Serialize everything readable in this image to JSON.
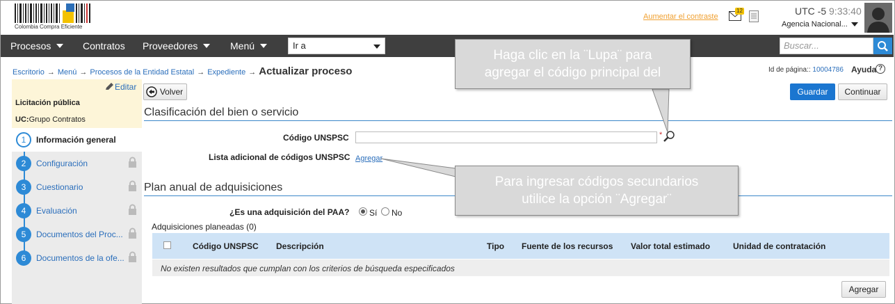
{
  "header": {
    "logo_text": "Colombia Compra Eficiente",
    "contrast_link": "Aumentar el contraste",
    "mail_count": "12",
    "utc_label": "UTC -5",
    "time": "9:33:40",
    "agency": "Agencia Nacional..."
  },
  "nav": {
    "items": [
      "Procesos",
      "Contratos",
      "Proveedores",
      "Menú"
    ],
    "goto": "Ir a",
    "search_placeholder": "Buscar..."
  },
  "breadcrumb": {
    "items": [
      "Escritorio",
      "Menú",
      "Procesos de la Entidad Estatal",
      "Expediente"
    ],
    "separator": "→",
    "current": "Actualizar proceso"
  },
  "page_meta": {
    "id_label": "Id de página::",
    "id_value": "10004786",
    "help": "Ayuda",
    "help_icon_glyph": "?"
  },
  "sidebar": {
    "edit": "Editar",
    "process_type": "Licitación pública",
    "uc_label": "UC:",
    "uc_value": "Grupo Contratos",
    "steps": [
      {
        "num": "1",
        "label": "Información general"
      },
      {
        "num": "2",
        "label": "Configuración"
      },
      {
        "num": "3",
        "label": "Cuestionario"
      },
      {
        "num": "4",
        "label": "Evaluación"
      },
      {
        "num": "5",
        "label": "Documentos del Proc..."
      },
      {
        "num": "6",
        "label": "Documentos de la ofe..."
      }
    ]
  },
  "toolbar": {
    "back": "Volver",
    "save": "Guardar",
    "continue": "Continuar"
  },
  "section1": {
    "title": "Clasificación del bien o servicio",
    "code_label": "Código UNSPSC",
    "required_mark": "*",
    "extra_label": "Lista adicional de códigos UNSPSC",
    "add_link": "Agregar"
  },
  "section2": {
    "title": "Plan anual de adquisiciones",
    "question": "¿Es una adquisición del PAA?",
    "yes": "Sí",
    "no": "No",
    "planned": "Adquisiciones planeadas (0)",
    "columns": [
      "Código UNSPSC",
      "Descripción",
      "Tipo",
      "Fuente de los recursos",
      "Valor total estimado",
      "Unidad de contratación"
    ],
    "empty": "No existen resultados que cumplan con los criterios de búsqueda especificados",
    "add_button": "Agregar"
  },
  "callouts": {
    "lupa_line1": "Haga clic en la ¨Lupa¨ para",
    "lupa_line2": "agregar el código principal del",
    "agregar_line1": "Para ingresar códigos secundarios",
    "agregar_line2": "utilice la opción ¨Agregar¨"
  },
  "colors": {
    "nav_bg": "#3f3f3f",
    "primary": "#1b76d0",
    "link": "#2a6ebb",
    "contrast_link": "#f0a030",
    "table_header": "#cfe3f6",
    "sidebar_top": "#fdf5d8"
  }
}
